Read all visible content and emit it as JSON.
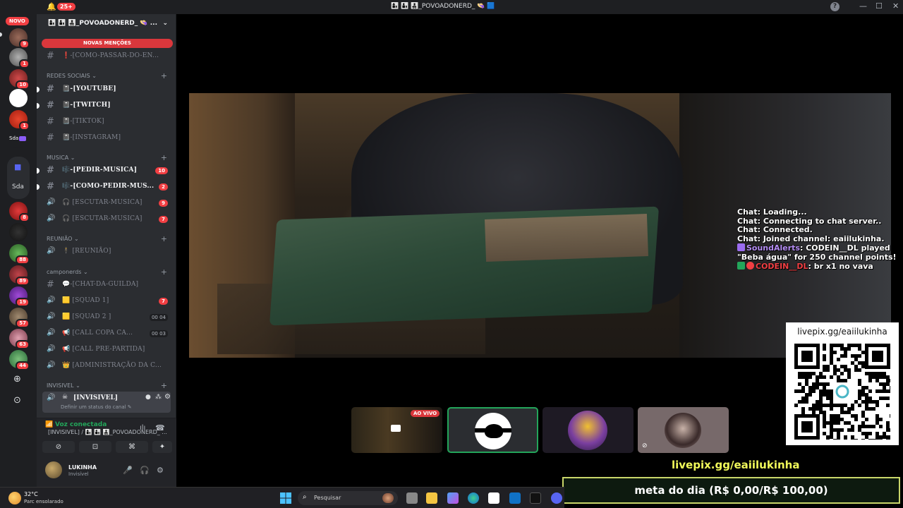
{
  "titlebar": {
    "notif_count": "25+",
    "title": "👩‍👦 👨‍👦 👨‍👧‍👦_POVOADONERD_ 👒 🟦",
    "help": "?",
    "minimize": "—",
    "maximize": "☐",
    "close": "✕"
  },
  "rail": {
    "novo_label": "NOVO",
    "badges": [
      "9",
      "1",
      "10",
      "1",
      "8",
      "88",
      "89",
      "19",
      "57",
      "63",
      "44"
    ],
    "folder_label": "Sda",
    "sda_small": "Sda"
  },
  "server": {
    "name": "👩‍👦 👨‍👦 👨‍👧‍👦_POVOADONERD_ 👒 ...",
    "mentions_label": "NOVAS MENÇÕES",
    "top_channel": "❗-[COMO-PASSAR-DO-EN...",
    "categories": {
      "social": "REDES SOCIAIS",
      "music": "MUSICA",
      "meeting": "REUNIÃO",
      "camp": "camponerds",
      "invis": "INVISIVEL"
    },
    "channels": [
      {
        "name": "📓-[YOUTUBE]",
        "unread": true
      },
      {
        "name": "📓-[TWITCH]",
        "unread": true
      },
      {
        "name": "📓-[TIKTOK]",
        "unread": false
      },
      {
        "name": "📓-[INSTAGRAM]",
        "unread": false
      },
      {
        "name": "🎼-[PEDIR-MUSICA]",
        "unread": true,
        "count": "10"
      },
      {
        "name": "🎼-[COMO-PEDIR-MUS...",
        "unread": true,
        "count": "2"
      },
      {
        "name": "🎧 [ESCUTAR-MUSICA]",
        "unread": false,
        "count": "9"
      },
      {
        "name": "🎧 [ESCUTAR-MUSICA]",
        "unread": false,
        "count": "7"
      },
      {
        "name": "🕴 [REUNIÃO]",
        "unread": false
      },
      {
        "name": "💬-[CHAT-DA-GUILDA]",
        "unread": false
      },
      {
        "name": "🟨 [SQUAD 1]",
        "unread": false,
        "count": "7"
      },
      {
        "name": "🟨 [SQUAD 2 ]",
        "unread": false,
        "users": "00 04"
      },
      {
        "name": "📢 [CALL COPA CA...",
        "unread": false,
        "users": "00 03"
      },
      {
        "name": "📢 [CALL PRE-PARTIDA]",
        "unread": false
      },
      {
        "name": "👑 [ADMINISTRAÇÃO DA C...",
        "unread": false
      }
    ],
    "selected_channel": {
      "name": "[INVISIVEL]",
      "sub": "Definir um status do canal ✎"
    }
  },
  "voice": {
    "status": "Voz conectada",
    "channel": "[INVISIVEL] / 👩‍👦 👨‍👦 👨‍👧‍👦_POVOADONERD_ ..."
  },
  "user": {
    "name": "LUKINHA",
    "status": "Invisível"
  },
  "chat": {
    "lines": [
      "Chat: Loading...",
      "Chat: Connecting to chat server..",
      "Chat: Connected.",
      "Chat: Joined channel: eaiilukinha."
    ],
    "sa_user": "SoundAlerts",
    "sa_text": ": CODEIN__DL played \"Beba água\" for 250 channel points!",
    "msg_user": "CODEIN__DL",
    "msg_text": ": br x1 no vava"
  },
  "overlay": {
    "qr_url": "livepix.gg/eaiilukinha",
    "livepix": "livepix.gg/eaiilukinha",
    "meta": "meta do dia (R$ 0,00/R$ 100,00)",
    "live_badge": "AO VIVO"
  },
  "taskbar": {
    "temp": "32°C",
    "condition": "Parc ensolarado",
    "search_placeholder": "Pesquisar"
  },
  "colors": {
    "discord_red": "#f23f43",
    "discord_green": "#23a55a",
    "livepix_yellow": "#f1f95a"
  }
}
